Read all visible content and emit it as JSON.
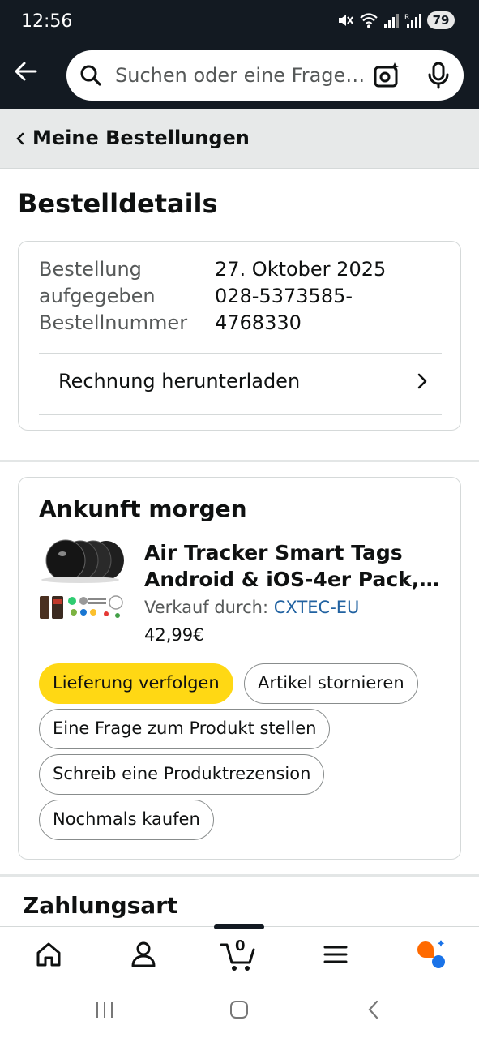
{
  "status_bar": {
    "time": "12:56",
    "battery": "79"
  },
  "search": {
    "placeholder": "Suchen oder eine Frage…"
  },
  "breadcrumb": {
    "label": "Meine Bestellungen"
  },
  "page": {
    "title": "Bestelldetails"
  },
  "order": {
    "placed_label": "Bestellung aufgegeben",
    "placed_label_line1": "Bestellung",
    "placed_label_line2": "aufgegeben",
    "placed_value": "27. Oktober 2025",
    "number_label": "Bestellnummer",
    "number_value_line1": "028-5373585-",
    "number_value_line2": "4768330",
    "invoice_link": "Rechnung herunterladen"
  },
  "shipment": {
    "heading": "Ankunft morgen",
    "product_title_line1": "Air Tracker Smart Tags",
    "product_title_line2": "Android & iOS-4er Pack, D...",
    "seller_prefix": "Verkauf durch:",
    "seller_name": "CXTEC-EU",
    "price": "42,99€",
    "actions": {
      "track": "Lieferung verfolgen",
      "cancel": "Artikel stornieren",
      "ask": "Eine Frage zum Produkt stellen",
      "review": "Schreib eine Produktrezension",
      "rebuy": "Nochmals kaufen"
    }
  },
  "payment": {
    "title": "Zahlungsart"
  },
  "bottom_nav": {
    "cart_count": "0"
  },
  "colors": {
    "header_bg": "#131a22",
    "primary_button": "#ffd814",
    "link": "#2162a1"
  }
}
